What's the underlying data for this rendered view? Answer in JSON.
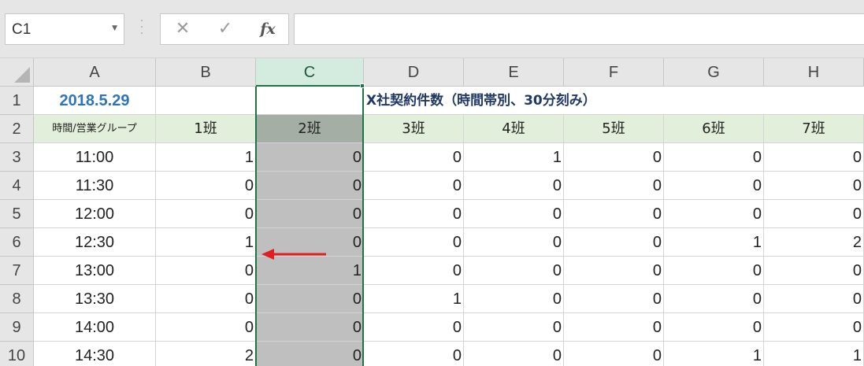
{
  "name_box": {
    "value": "C1"
  },
  "formula_bar": {
    "cancel_icon": "✕",
    "enter_icon": "✓",
    "function_label": "fx",
    "formula": ""
  },
  "columns": [
    "A",
    "B",
    "C",
    "D",
    "E",
    "F",
    "G",
    "H"
  ],
  "selected_column": "C",
  "row_numbers": [
    "1",
    "2",
    "3",
    "4",
    "5",
    "6",
    "7",
    "8",
    "9",
    "10"
  ],
  "sheet": {
    "a1_date": "2018.5.29",
    "title": "X社契約件数（時間帯別、30分刻み）",
    "group_header": "時間/営業グループ",
    "teams": [
      "1班",
      "2班",
      "3班",
      "4班",
      "5班",
      "6班",
      "7班"
    ],
    "rows": [
      {
        "time": "11:00",
        "values": [
          "1",
          "0",
          "0",
          "1",
          "0",
          "0",
          "0"
        ]
      },
      {
        "time": "11:30",
        "values": [
          "0",
          "0",
          "0",
          "0",
          "0",
          "0",
          "0"
        ]
      },
      {
        "time": "12:00",
        "values": [
          "0",
          "0",
          "0",
          "0",
          "0",
          "0",
          "0"
        ]
      },
      {
        "time": "12:30",
        "values": [
          "1",
          "0",
          "0",
          "0",
          "0",
          "1",
          "2"
        ]
      },
      {
        "time": "13:00",
        "values": [
          "0",
          "1",
          "0",
          "0",
          "0",
          "0",
          "0"
        ]
      },
      {
        "time": "13:30",
        "values": [
          "0",
          "0",
          "1",
          "0",
          "0",
          "0",
          "0"
        ]
      },
      {
        "time": "14:00",
        "values": [
          "0",
          "0",
          "0",
          "0",
          "0",
          "0",
          "0"
        ]
      },
      {
        "time": "14:30",
        "values": [
          "2",
          "0",
          "0",
          "0",
          "0",
          "1",
          "1"
        ]
      }
    ]
  },
  "annotation": {
    "arrow_color": "#e02020"
  },
  "colors": {
    "selection": "#217346",
    "header_fill": "#e2efda",
    "grey_fill": "#bfbfbf",
    "date_text": "#2e75b6",
    "title_text": "#1f3864"
  }
}
